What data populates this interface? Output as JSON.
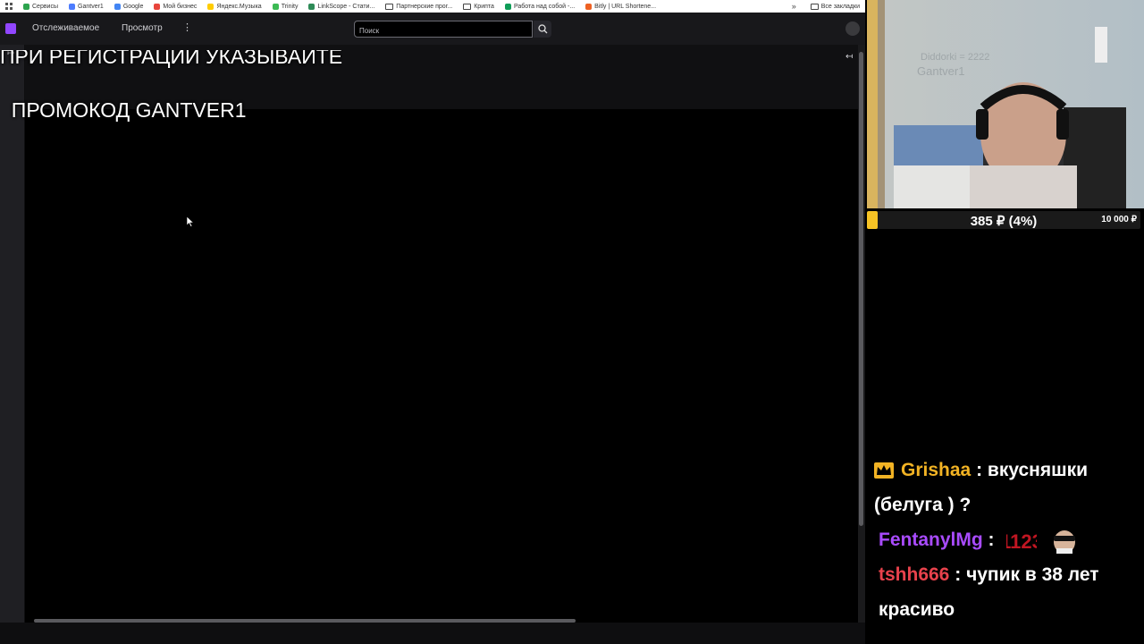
{
  "bookmarks": {
    "items": [
      {
        "label": "Сервисы",
        "color": "#2da44e"
      },
      {
        "label": "Gantver1",
        "color": "#4d7cfe"
      },
      {
        "label": "Google",
        "color": "#4285f4"
      },
      {
        "label": "Мой бизнес",
        "color": "#e8453c"
      },
      {
        "label": "Яндекс.Музыка",
        "color": "#ffcc00"
      },
      {
        "label": "Trinity",
        "color": "#3cba54"
      },
      {
        "label": "LinkScope - Стати...",
        "color": "#2e8b57"
      },
      {
        "label": "Партнерские прог...",
        "color": "folder"
      },
      {
        "label": "Крипта",
        "color": "folder"
      },
      {
        "label": "Работа над собой -...",
        "color": "#0f9d58"
      },
      {
        "label": "Bitly | URL Shortene...",
        "color": "#ee6123"
      }
    ],
    "all_bookmarks": "Все закладки"
  },
  "overlay": {
    "promo_line1": "ПРИ РЕГИСТРАЦИИ УКАЗЫВАЙТЕ",
    "promo_line2": "ПРОМОКОД GANTVER1"
  },
  "nav": {
    "following": "Отслеживаемое",
    "browse": "Просмотр",
    "more": "⋮",
    "search_placeholder": "Поиск"
  },
  "webcam": {
    "wall_text_1": "Diddorki = 2222",
    "wall_text_2": "Gantver1"
  },
  "goal": {
    "current": "385 ₽ (4%)",
    "target": "10 000 ₽",
    "progress_percent": 4,
    "fill_color": "#f6c325"
  },
  "chat": {
    "messages": [
      {
        "user": "Grishaa",
        "separator": ":",
        "text": "вкусняшки (белуга ) ?",
        "color": "#f2b324",
        "badge": "crown-icon"
      },
      {
        "user": "FentanylMg",
        "separator": ":",
        "text": "",
        "color": "#a94bff",
        "emotes": [
          "emote-1123",
          "emote-sunglasses-face"
        ]
      },
      {
        "user": "tshh666",
        "separator": ":",
        "text": "чупик в 38 лет красиво",
        "color": "#e8424c"
      }
    ]
  }
}
